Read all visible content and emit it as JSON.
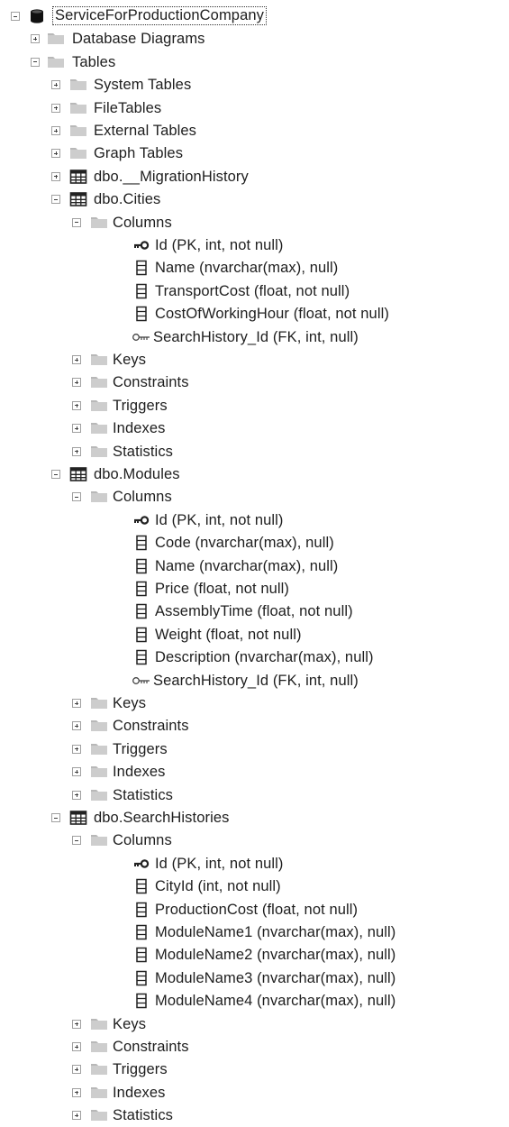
{
  "tree": {
    "root": {
      "label": "ServiceForProductionCompany",
      "icon": "database-icon",
      "expanded": true
    },
    "database_diagrams": {
      "label": "Database Diagrams",
      "icon": "folder-icon",
      "expanded": false
    },
    "tables": {
      "label": "Tables",
      "icon": "folder-icon",
      "expanded": true
    },
    "system_tables": {
      "label": "System Tables",
      "expanded": false
    },
    "file_tables": {
      "label": "FileTables",
      "expanded": false
    },
    "external_tables": {
      "label": "External Tables",
      "expanded": false
    },
    "graph_tables": {
      "label": "Graph Tables",
      "expanded": false
    },
    "migration_history": {
      "label": "dbo.__MigrationHistory",
      "icon": "table-icon",
      "expanded": false
    },
    "cities": {
      "label": "dbo.Cities",
      "icon": "table-icon",
      "expanded": true,
      "columns_folder": "Columns",
      "columns": [
        {
          "label": "Id (PK, int, not null)",
          "icon": "primary-key-icon"
        },
        {
          "label": "Name (nvarchar(max), null)",
          "icon": "column-icon"
        },
        {
          "label": "TransportCost (float, not null)",
          "icon": "column-icon"
        },
        {
          "label": "CostOfWorkingHour (float, not null)",
          "icon": "column-icon"
        },
        {
          "label": "SearchHistory_Id (FK, int, null)",
          "icon": "foreign-key-icon"
        }
      ],
      "folders": [
        "Keys",
        "Constraints",
        "Triggers",
        "Indexes",
        "Statistics"
      ]
    },
    "modules": {
      "label": "dbo.Modules",
      "icon": "table-icon",
      "expanded": true,
      "columns_folder": "Columns",
      "columns": [
        {
          "label": "Id (PK, int, not null)",
          "icon": "primary-key-icon"
        },
        {
          "label": "Code (nvarchar(max), null)",
          "icon": "column-icon"
        },
        {
          "label": "Name (nvarchar(max), null)",
          "icon": "column-icon"
        },
        {
          "label": "Price (float, not null)",
          "icon": "column-icon"
        },
        {
          "label": "AssemblyTime (float, not null)",
          "icon": "column-icon"
        },
        {
          "label": "Weight (float, not null)",
          "icon": "column-icon"
        },
        {
          "label": "Description (nvarchar(max), null)",
          "icon": "column-icon"
        },
        {
          "label": "SearchHistory_Id (FK, int, null)",
          "icon": "foreign-key-icon"
        }
      ],
      "folders": [
        "Keys",
        "Constraints",
        "Triggers",
        "Indexes",
        "Statistics"
      ]
    },
    "search_histories": {
      "label": "dbo.SearchHistories",
      "icon": "table-icon",
      "expanded": true,
      "columns_folder": "Columns",
      "columns": [
        {
          "label": "Id (PK, int, not null)",
          "icon": "primary-key-icon"
        },
        {
          "label": "CityId (int, not null)",
          "icon": "column-icon"
        },
        {
          "label": "ProductionCost (float, not null)",
          "icon": "column-icon"
        },
        {
          "label": "ModuleName1 (nvarchar(max), null)",
          "icon": "column-icon"
        },
        {
          "label": "ModuleName2 (nvarchar(max), null)",
          "icon": "column-icon"
        },
        {
          "label": "ModuleName3 (nvarchar(max), null)",
          "icon": "column-icon"
        },
        {
          "label": "ModuleName4 (nvarchar(max), null)",
          "icon": "column-icon"
        }
      ],
      "folders": [
        "Keys",
        "Constraints",
        "Triggers",
        "Indexes",
        "Statistics"
      ]
    }
  },
  "colors": {
    "folder": "#c9c9c9",
    "database": "#1a1a1a",
    "table_grid": "#2b2b2b",
    "text": "#1e1e1e"
  }
}
